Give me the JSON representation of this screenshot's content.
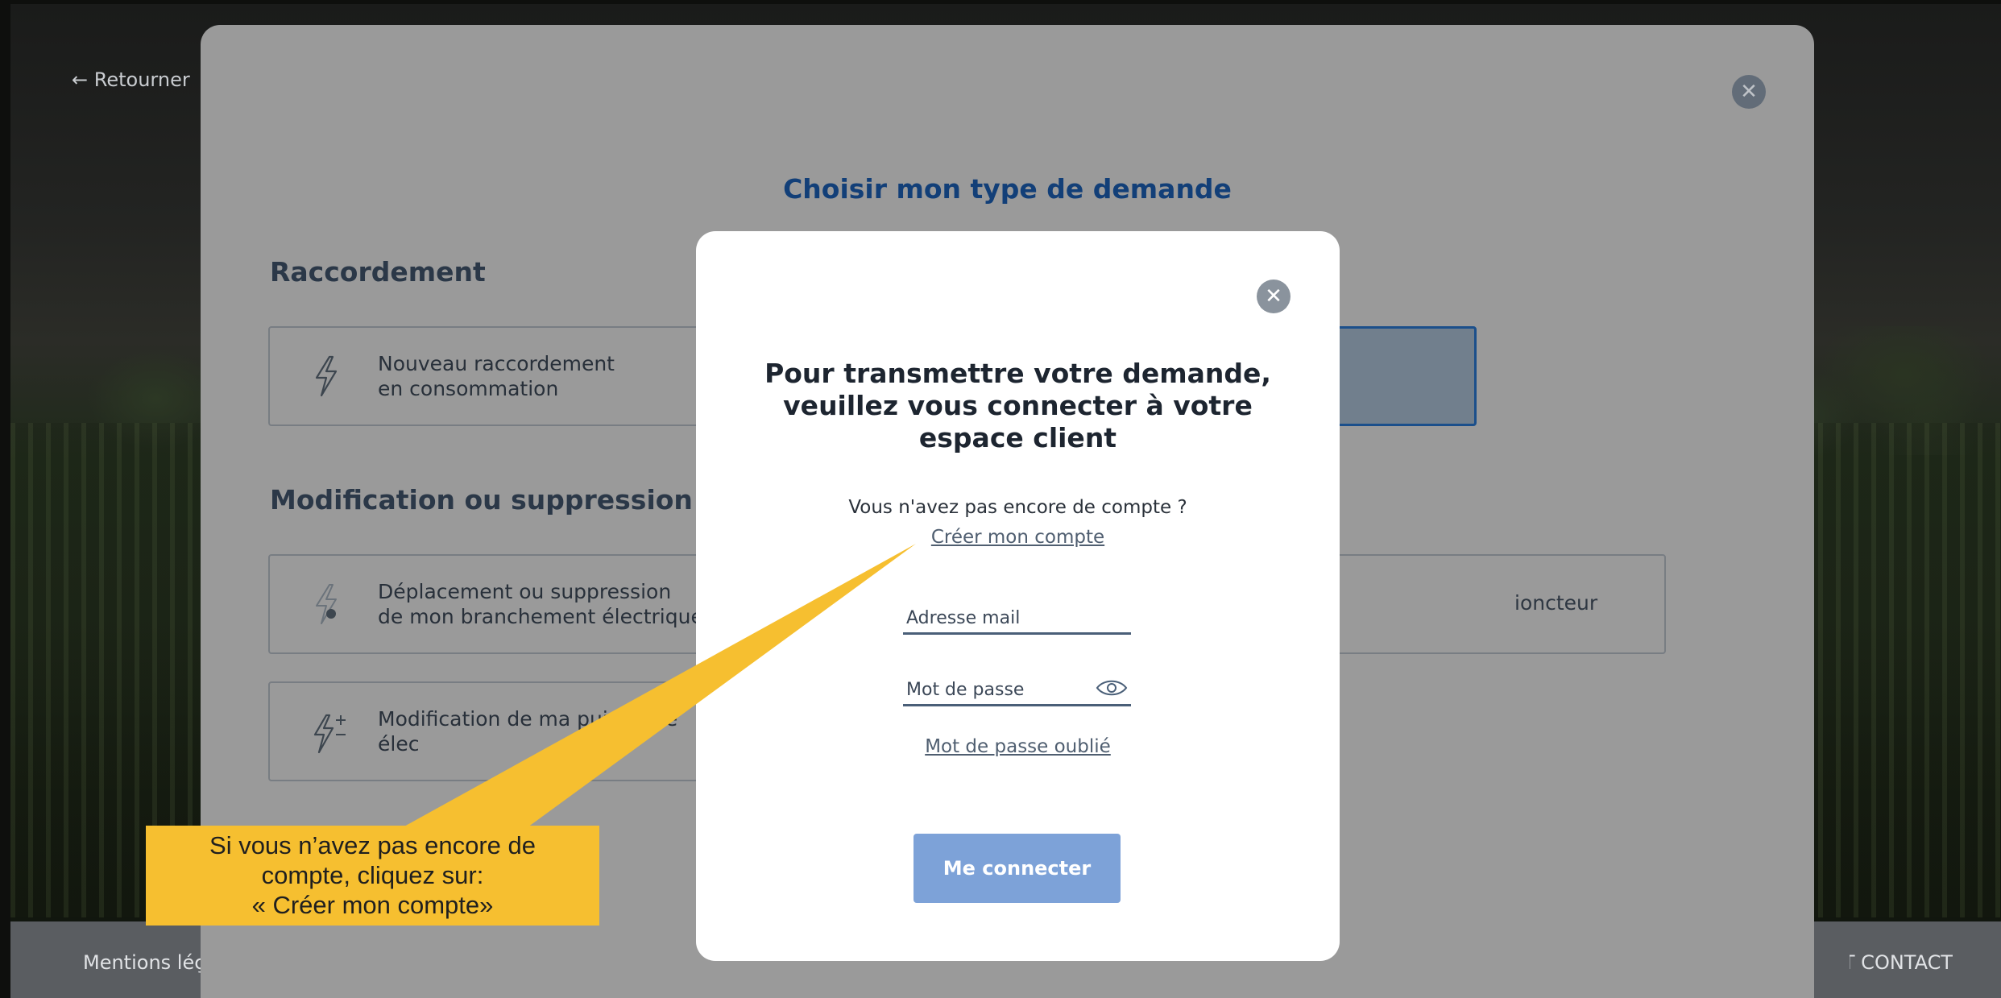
{
  "background": {
    "back_link": "← Retourner",
    "footer_left": "Mentions léç",
    "footer_right": "E ET CONTACT"
  },
  "request_modal": {
    "title": "Choisir mon type de demande",
    "sections": {
      "connection": "Raccordement",
      "modification": "Modification ou suppression de r"
    },
    "cards": [
      {
        "icon": "lightning-icon",
        "label": "Nouveau raccordement\nen consommation"
      },
      {
        "icon": "lightning-remove-icon",
        "label": "Déplacement ou suppression\nde mon branchement électrique"
      },
      {
        "icon": "lightning-plus-minus-icon",
        "label": "Modification de ma puissance élec"
      }
    ],
    "right_card_text": "ioncteur"
  },
  "login_modal": {
    "heading": "Pour transmettre votre demande, veuillez vous connecter à votre espace client",
    "no_account": "Vous n'avez pas encore de compte ?",
    "create_account": "Créer mon compte",
    "email_placeholder": "Adresse mail",
    "password_placeholder": "Mot de passe",
    "forgot_password": "Mot de passe oublié",
    "connect_button": "Me connecter"
  },
  "callout": {
    "line1": "Si vous n’avez pas encore de",
    "line2": "compte, cliquez sur:",
    "line3": "« Créer mon compte»",
    "color": "#f6bf30"
  }
}
